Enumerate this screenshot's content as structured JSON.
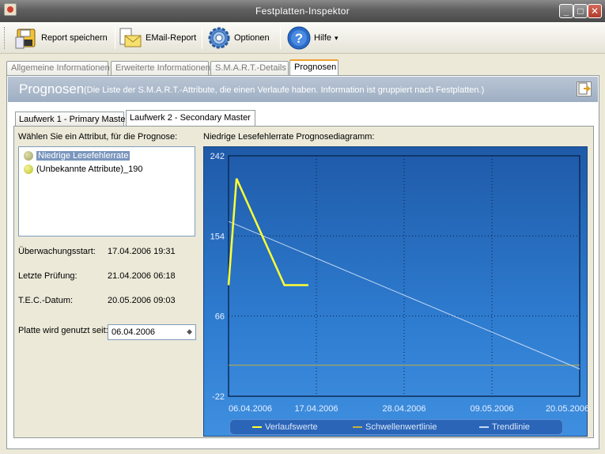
{
  "window": {
    "title": "Festplatten-Inspektor",
    "min_label": "_",
    "max_label": "□",
    "close_label": "✕"
  },
  "toolbar": {
    "report_label": "Report speichern",
    "email_label": "EMail-Report",
    "options_label": "Optionen",
    "help_label": "Hilfe",
    "help_arrow": "▾"
  },
  "tabs": [
    {
      "label": "Allgemeine Informationen",
      "active": false
    },
    {
      "label": "Erweiterte Informationen",
      "active": false
    },
    {
      "label": "S.M.A.R.T.-Details",
      "active": false
    },
    {
      "label": "Prognosen",
      "active": true
    }
  ],
  "header": {
    "title": "Prognosen",
    "subtitle": "(Die Liste der S.M.A.R.T.-Attribute, die einen Verlaufe haben. Information ist gruppiert nach Festplatten.)"
  },
  "drive_tabs": [
    {
      "label": "Laufwerk 1 - Primary Master",
      "active": false
    },
    {
      "label": "Laufwerk 2 - Secondary Master",
      "active": true
    }
  ],
  "attributes": {
    "prompt": "Wählen Sie ein Attribut, für die Prognose:",
    "items": [
      {
        "label": "Niedrige Lesefehlerrate",
        "selected": true
      },
      {
        "label": "(Unbekannte Attribute)_190",
        "selected": false
      }
    ]
  },
  "info": {
    "monitor_start_label": "Überwachungsstart:",
    "monitor_start_value": "17.04.2006 19:31",
    "last_check_label": "Letzte Prüfung:",
    "last_check_value": "21.04.2006 06:18",
    "tec_label": "T.E.C.-Datum:",
    "tec_value": "20.05.2006 09:03",
    "used_since_label": "Platte wird genutzt seit:",
    "used_since_value": "06.04.2006"
  },
  "chart_data": {
    "type": "line",
    "title": "Niedrige Lesefehlerrate Prognosediagramm:",
    "x_tick_labels": [
      "06.04.2006",
      "17.04.2006",
      "28.04.2006",
      "09.05.2006",
      "20.05.2006"
    ],
    "y_tick_labels": [
      "242",
      "154",
      "66",
      "-22"
    ],
    "ylim": [
      -22,
      242
    ],
    "xlim": [
      "06.04.2006",
      "20.05.2006"
    ],
    "grid": true,
    "legend_position": "bottom",
    "series": [
      {
        "name": "Verlaufswerte",
        "color": "#ffff33",
        "points": [
          [
            "06.04.2006",
            100
          ],
          [
            "07.04.2006",
            217
          ],
          [
            "13.04.2006",
            100
          ],
          [
            "16.04.2006",
            100
          ]
        ]
      },
      {
        "name": "Schwellenwertlinie",
        "color": "#c8b040",
        "points": [
          [
            "06.04.2006",
            12
          ],
          [
            "20.05.2006",
            12
          ]
        ]
      },
      {
        "name": "Trendlinie",
        "color": "#c6daf2",
        "points": [
          [
            "06.04.2006",
            170
          ],
          [
            "20.05.2006",
            8
          ]
        ]
      }
    ]
  },
  "colors": {
    "chart_bg": "#2e7cd0",
    "header_bg": "#9eafc3",
    "active_tab_accent": "#f0a030"
  }
}
